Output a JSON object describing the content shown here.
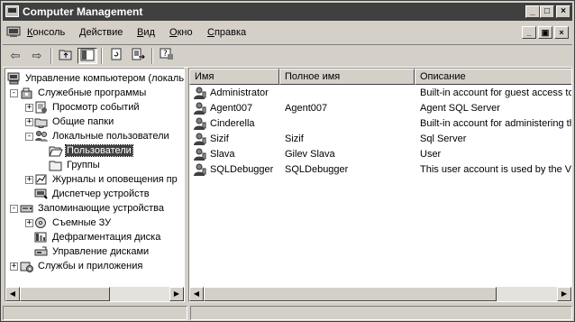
{
  "window": {
    "title": "Computer Management",
    "controls": [
      "minimize",
      "maximize",
      "close"
    ]
  },
  "menu": {
    "items": [
      {
        "label": "Консоль",
        "u": "К",
        "rest": "онсоль"
      },
      {
        "label": "Действие",
        "u": "Д",
        "rest": "ействие"
      },
      {
        "label": "Вид",
        "u": "В",
        "rest": "ид"
      },
      {
        "label": "Окно",
        "u": "О",
        "rest": "кно"
      },
      {
        "label": "Справка",
        "u": "С",
        "rest": "правка"
      }
    ]
  },
  "toolbar": {
    "icons": [
      "back-icon",
      "forward-icon",
      "up-folder-icon",
      "show-hide-tree-icon",
      "refresh-icon",
      "export-list-icon",
      "help-icon"
    ]
  },
  "tree": {
    "items": [
      {
        "label": "Управление компьютером (локаль",
        "level": 0,
        "expander": "",
        "icon": "computer-icon"
      },
      {
        "label": "Служебные программы",
        "level": 1,
        "expander": "−",
        "icon": "tools-icon"
      },
      {
        "label": "Просмотр событий",
        "level": 2,
        "expander": "+",
        "icon": "event-viewer-icon"
      },
      {
        "label": "Общие папки",
        "level": 2,
        "expander": "+",
        "icon": "shared-folders-icon"
      },
      {
        "label": "Локальные пользователи",
        "level": 2,
        "expander": "−",
        "icon": "users-icon"
      },
      {
        "label": "Пользователи",
        "level": 3,
        "expander": "",
        "icon": "folder-open-icon",
        "selected": true
      },
      {
        "label": "Группы",
        "level": 3,
        "expander": "",
        "icon": "folder-icon"
      },
      {
        "label": "Журналы и оповещения пр",
        "level": 2,
        "expander": "+",
        "icon": "logs-alerts-icon"
      },
      {
        "label": "Диспетчер устройств",
        "level": 2,
        "expander": "",
        "icon": "device-manager-icon"
      },
      {
        "label": "Запоминающие устройства",
        "level": 1,
        "expander": "−",
        "icon": "storage-icon"
      },
      {
        "label": "Съемные ЗУ",
        "level": 2,
        "expander": "+",
        "icon": "removable-storage-icon"
      },
      {
        "label": "Дефрагментация диска",
        "level": 2,
        "expander": "",
        "icon": "defrag-icon"
      },
      {
        "label": "Управление дисками",
        "level": 2,
        "expander": "",
        "icon": "disk-management-icon"
      },
      {
        "label": "Службы и приложения",
        "level": 1,
        "expander": "+",
        "icon": "services-apps-icon"
      }
    ]
  },
  "list": {
    "columns": [
      "Имя",
      "Полное имя",
      "Описание"
    ],
    "rows": [
      {
        "name": "Administrator",
        "fullname": "",
        "description": "Built-in account for guest access to"
      },
      {
        "name": "Agent007",
        "fullname": "Agent007",
        "description": "Agent SQL Server"
      },
      {
        "name": "Cinderella",
        "fullname": "",
        "description": "Built-in account for administering th"
      },
      {
        "name": "Sizif",
        "fullname": "Sizif",
        "description": "Sql Server"
      },
      {
        "name": "Slava",
        "fullname": "Gilev Slava",
        "description": "User"
      },
      {
        "name": "SQLDebugger",
        "fullname": "SQLDebugger",
        "description": "This user account is used by the Vis"
      }
    ],
    "row_icon": "user-icon"
  }
}
